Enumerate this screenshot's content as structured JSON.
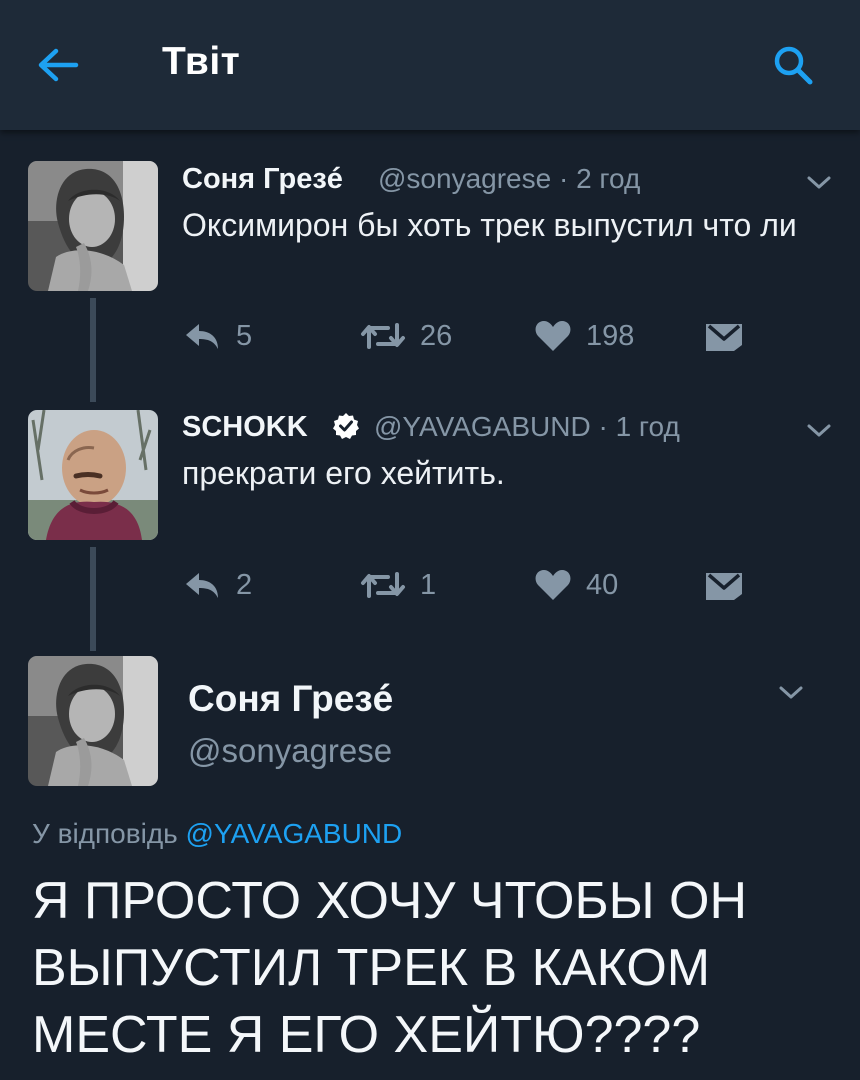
{
  "header": {
    "title": "Твіт"
  },
  "tweets": [
    {
      "name": "Соня Грезé",
      "meta": "@sonyagrese · 2 год",
      "text": "Оксимирон бы хоть трек выпустил что ли",
      "replies": "5",
      "retweets": "26",
      "likes": "198"
    },
    {
      "name": "SCHOKK",
      "meta": "@YAVAGABUND · 1 год",
      "text": "прекрати его хейтить.",
      "replies": "2",
      "retweets": "1",
      "likes": "40"
    }
  ],
  "main_tweet": {
    "name": "Соня Грезé",
    "handle": "@sonyagrese",
    "reply_prefix": "У відповідь",
    "reply_handle": "@YAVAGABUND",
    "text": "Я ПРОСТО ХОЧУ ЧТОБЫ ОН ВЫПУСТИЛ ТРЕК В КАКОМ МЕСТЕ Я ЕГО ХЕЙТЮ????"
  },
  "colors": {
    "background": "#17202c",
    "header": "#1e2a38",
    "accent": "#1da1f2",
    "muted": "#8596a6"
  }
}
